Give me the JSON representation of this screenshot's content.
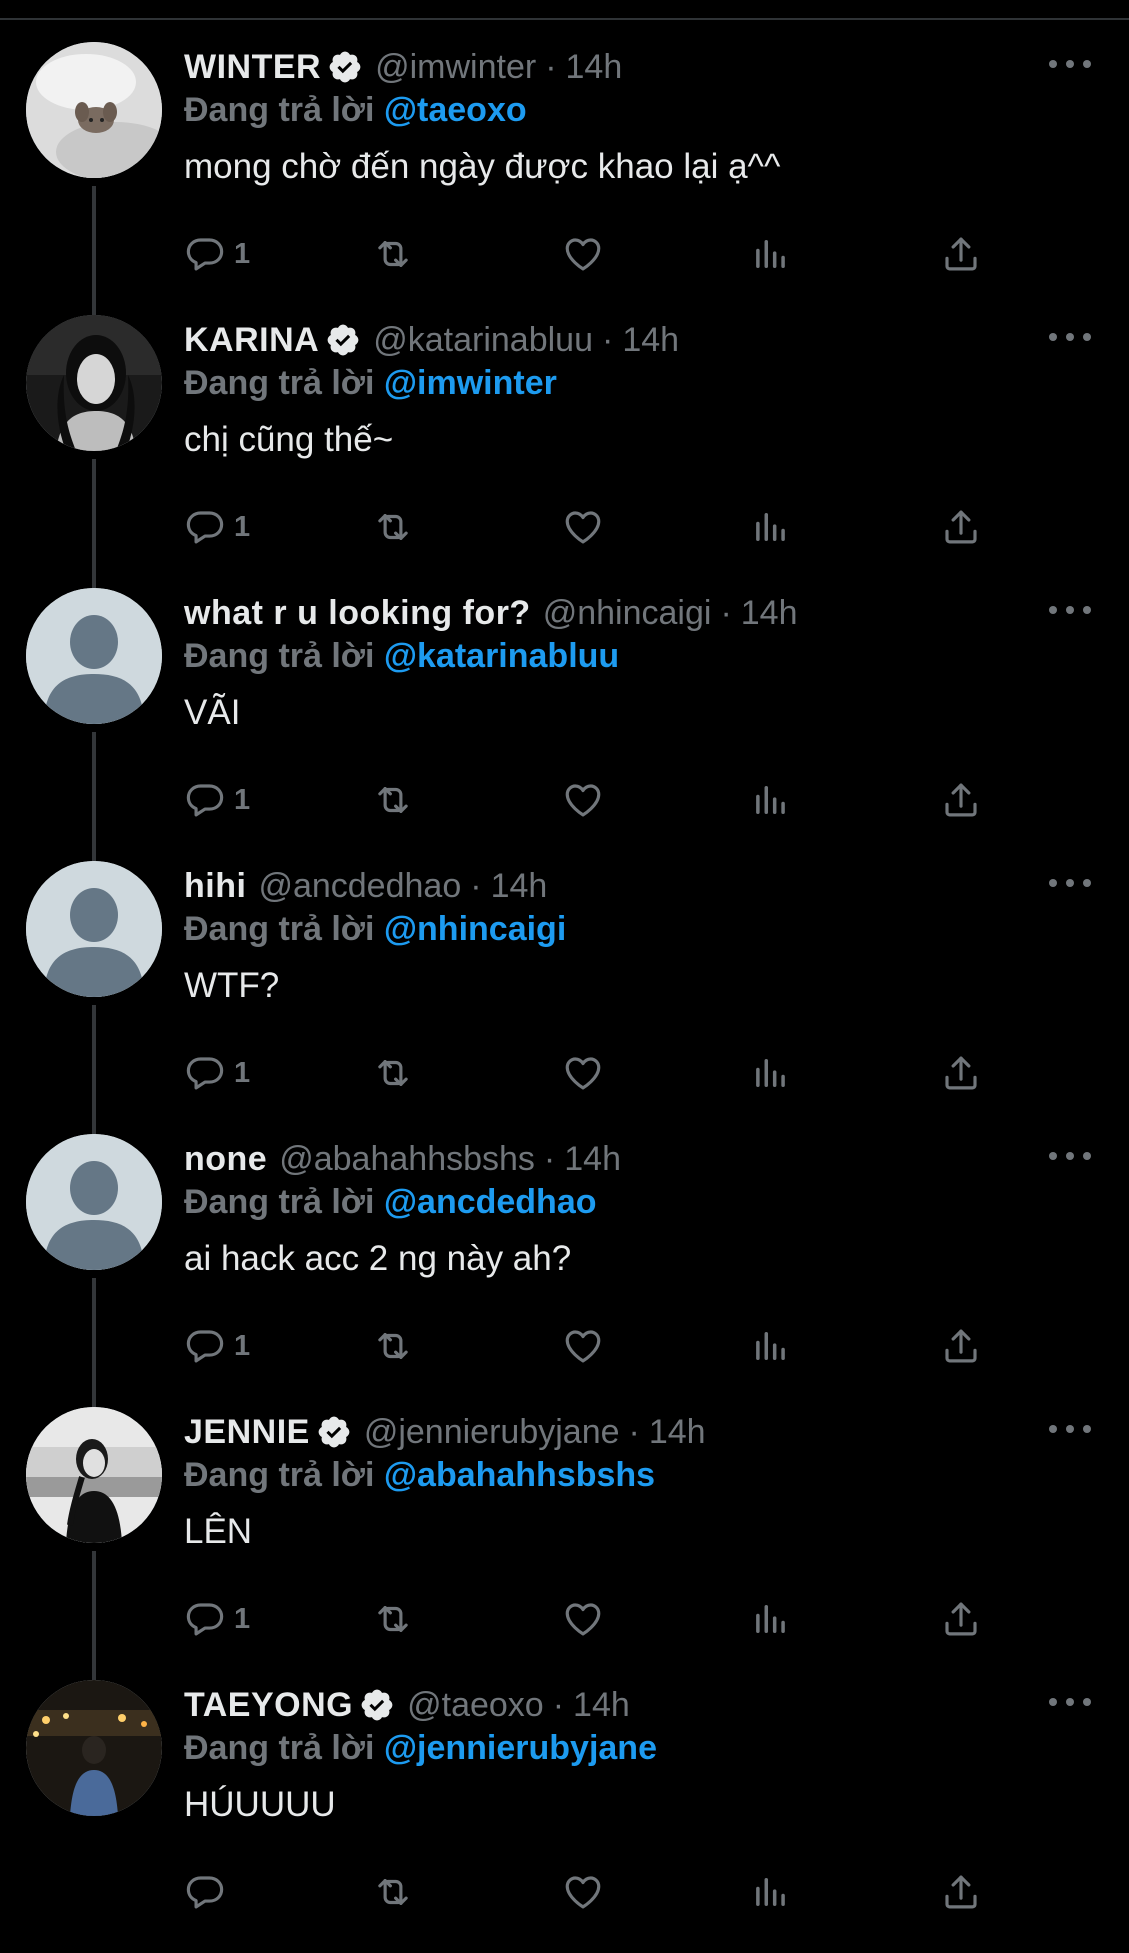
{
  "reply_prefix": "Đang trả lời",
  "colors": {
    "background": "#000000",
    "primary_text": "#e7e9ea",
    "secondary_text": "#71767b",
    "accent": "#1d9bf0",
    "verified_badge": "#e7e9ea"
  },
  "icons": {
    "reply": "reply-bubble-icon",
    "retweet": "retweet-icon",
    "like": "heart-icon",
    "views": "analytics-bars-icon",
    "share": "share-upload-icon",
    "more": "more-dots-icon",
    "verified": "verified-badge-icon"
  },
  "tweets": [
    {
      "display_name": "WINTER",
      "verified": true,
      "handle": "@imwinter",
      "separator": "·",
      "time": "14h",
      "reply_to": "@taeoxo",
      "text": "mong chờ đến ngày được khao lại ạ^^",
      "reply_count": "1",
      "avatar": "photo-winter"
    },
    {
      "display_name": "KARINA",
      "verified": true,
      "handle": "@katarinabluu",
      "separator": "·",
      "time": "14h",
      "reply_to": "@imwinter",
      "text": "chị cũng thế~",
      "reply_count": "1",
      "avatar": "photo-karina"
    },
    {
      "display_name": "what r u looking for?",
      "verified": false,
      "handle": "@nhincaigi",
      "separator": "·",
      "time": "14h",
      "reply_to": "@katarinabluu",
      "text": "VÃI",
      "reply_count": "1",
      "avatar": "default"
    },
    {
      "display_name": "hihi",
      "verified": false,
      "handle": "@ancdedhao",
      "separator": "·",
      "time": "14h",
      "reply_to": "@nhincaigi",
      "text": "WTF?",
      "reply_count": "1",
      "avatar": "default"
    },
    {
      "display_name": "none",
      "verified": false,
      "handle": "@abahahhsbshs",
      "separator": "·",
      "time": "14h",
      "reply_to": "@ancdedhao",
      "text": "ai hack acc 2 ng này ah?",
      "reply_count": "1",
      "avatar": "default"
    },
    {
      "display_name": "JENNIE",
      "verified": true,
      "handle": "@jennierubyjane",
      "separator": "·",
      "time": "14h",
      "reply_to": "@abahahhsbshs",
      "text": "LÊN",
      "reply_count": "1",
      "avatar": "photo-jennie"
    },
    {
      "display_name": "TAEYONG",
      "verified": true,
      "handle": "@taeoxo",
      "separator": "·",
      "time": "14h",
      "reply_to": "@jennierubyjane",
      "text": "HÚUUUU",
      "reply_count": "",
      "avatar": "photo-taeyong"
    }
  ]
}
